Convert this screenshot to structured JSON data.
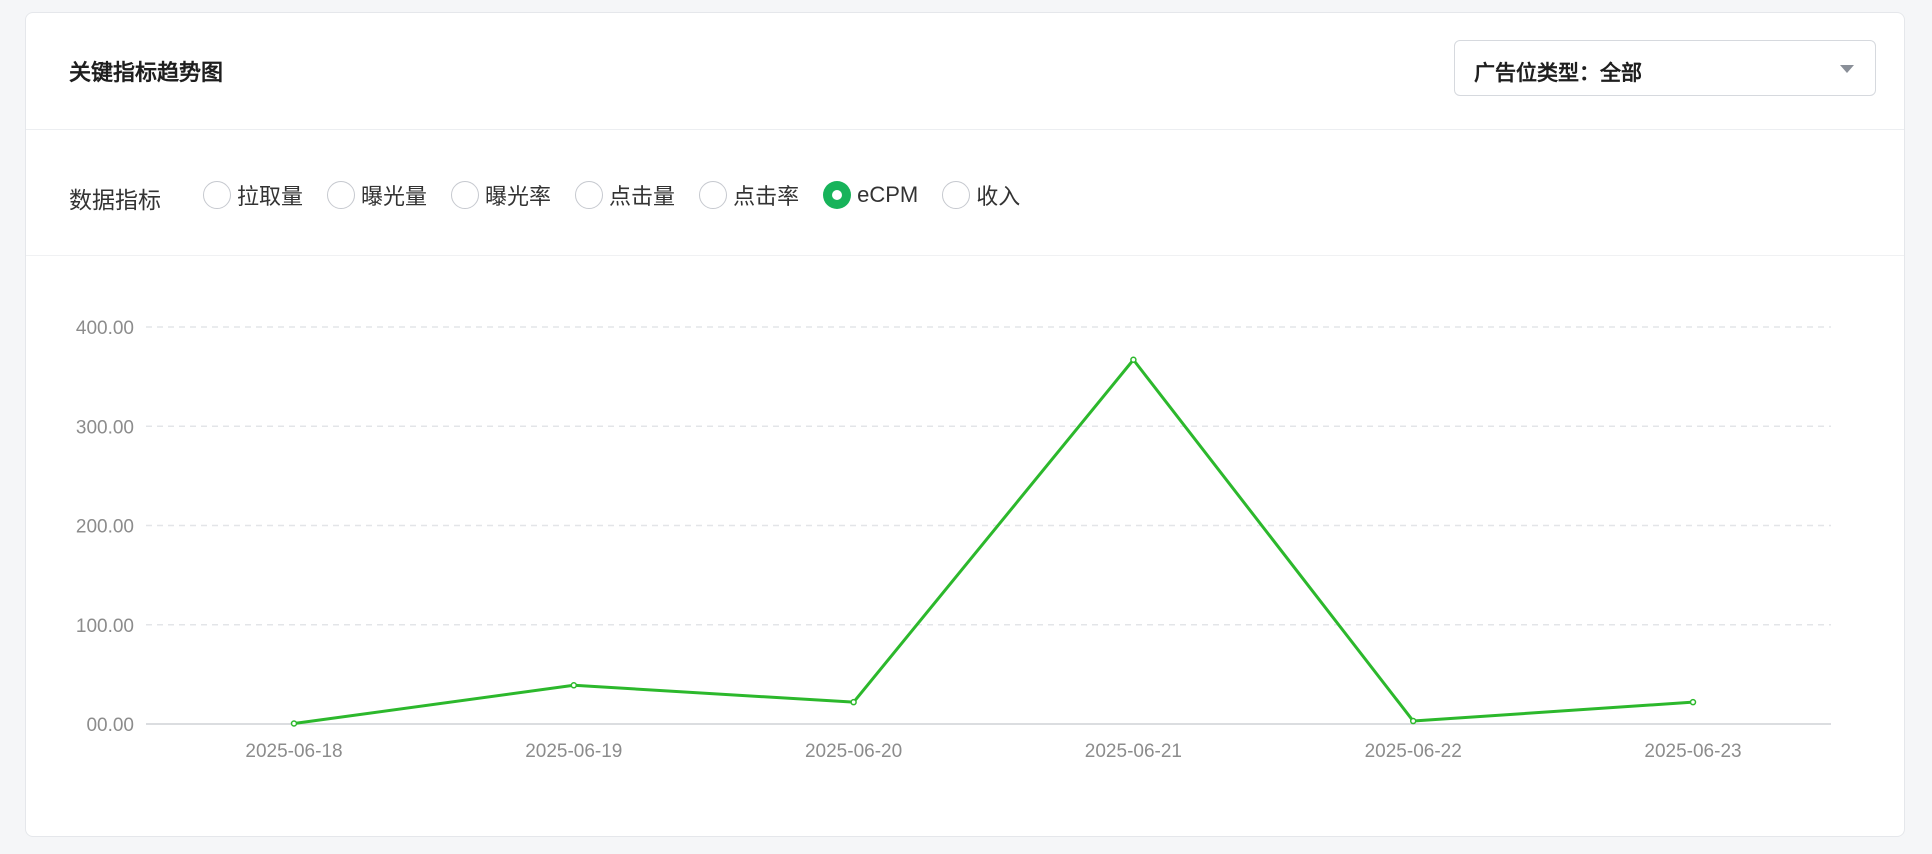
{
  "card": {
    "title": "关键指标趋势图",
    "ad_type_select": {
      "label": "广告位类型：全部",
      "value": "全部"
    }
  },
  "metrics": {
    "label": "数据指标",
    "options": [
      {
        "label": "拉取量",
        "checked": false
      },
      {
        "label": "曝光量",
        "checked": false
      },
      {
        "label": "曝光率",
        "checked": false
      },
      {
        "label": "点击量",
        "checked": false
      },
      {
        "label": "点击率",
        "checked": false
      },
      {
        "label": "eCPM",
        "checked": true
      },
      {
        "label": "收入",
        "checked": false
      }
    ]
  },
  "colors": {
    "accent": "#17b35a",
    "line": "#2cb82c",
    "grid": "#e3e5e8",
    "axis_text": "#8c8c8c"
  },
  "chart_data": {
    "type": "line",
    "x": [
      "2025-06-18",
      "2025-06-19",
      "2025-06-20",
      "2025-06-21",
      "2025-06-22",
      "2025-06-23"
    ],
    "series": [
      {
        "values": [
          0.5,
          39,
          22,
          367,
          3,
          22
        ]
      }
    ],
    "y_ticks": [
      "00.00",
      "100.00",
      "200.00",
      "300.00",
      "400.00"
    ],
    "ylim": [
      0,
      400
    ],
    "grid": true,
    "legend": "none"
  }
}
